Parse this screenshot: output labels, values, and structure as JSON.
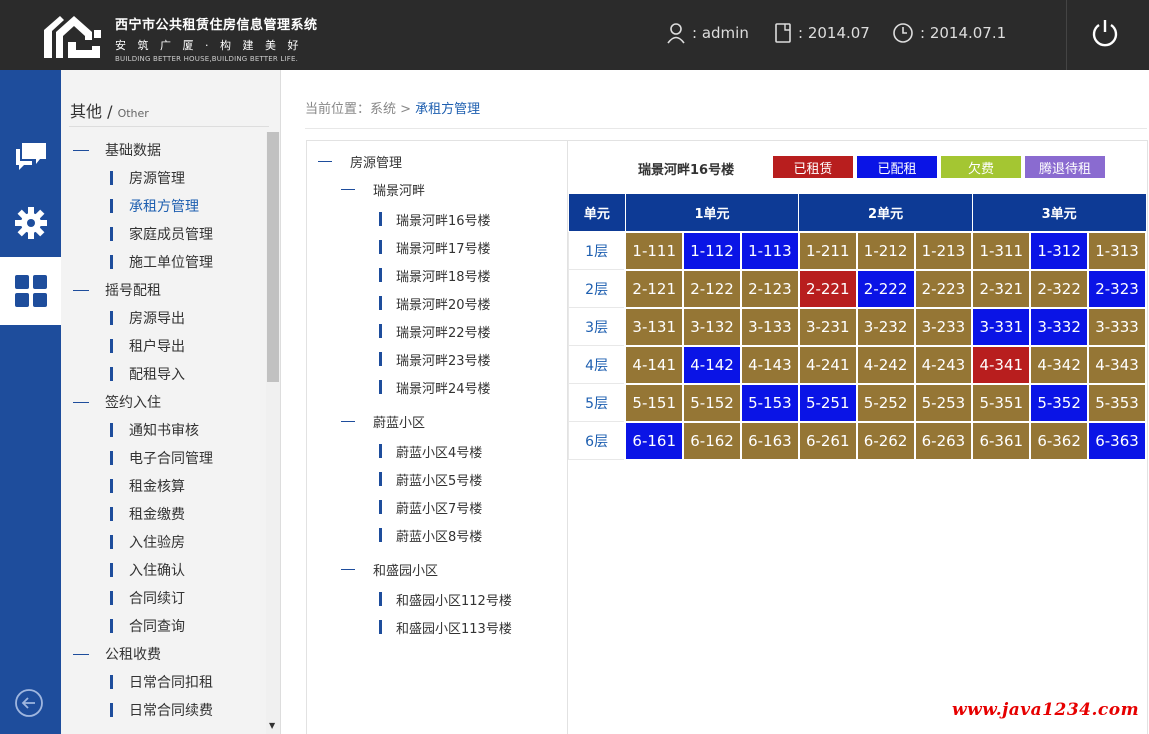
{
  "header": {
    "title": "西宁市公共租赁住房信息管理系统",
    "slogan": "安 筑 广 厦 · 构 建 美 好",
    "slogan_en": "BUILDING BETTER HOUSE,BUILDING BETTER LIFE.",
    "user_label": ": admin",
    "period_label": ": 2014.07",
    "date_label": ": 2014.07.1"
  },
  "sidebar": {
    "title": "其他",
    "title_sep": " / ",
    "title_en": "Other",
    "groups": [
      {
        "label": "基础数据",
        "items": [
          "房源管理",
          "承租方管理",
          "家庭成员管理",
          "施工单位管理"
        ]
      },
      {
        "label": "摇号配租",
        "items": [
          "房源导出",
          "租户导出",
          "配租导入"
        ]
      },
      {
        "label": "签约入住",
        "items": [
          "通知书审核",
          "电子合同管理",
          "租金核算",
          "租金缴费",
          "入住验房",
          "入住确认",
          "合同续订",
          "合同查询"
        ]
      },
      {
        "label": "公租收费",
        "items": [
          "日常合同扣租",
          "日常合同续费"
        ]
      }
    ],
    "active_item": "承租方管理"
  },
  "breadcrumb": {
    "prefix": "当前位置：系统 > ",
    "current": "承租方管理"
  },
  "tree": {
    "root": "房源管理",
    "groups": [
      {
        "label": "瑞景河畔",
        "items": [
          "瑞景河畔16号楼",
          "瑞景河畔17号楼",
          "瑞景河畔18号楼",
          "瑞景河畔20号楼",
          "瑞景河畔22号楼",
          "瑞景河畔23号楼",
          "瑞景河畔24号楼"
        ]
      },
      {
        "label": "蔚蓝小区",
        "items": [
          "蔚蓝小区4号楼",
          "蔚蓝小区5号楼",
          "蔚蓝小区7号楼",
          "蔚蓝小区8号楼"
        ]
      },
      {
        "label": "和盛园小区",
        "items": [
          "和盛园小区112号楼",
          "和盛园小区113号楼"
        ]
      }
    ]
  },
  "building": {
    "name": "瑞景河畔16号楼",
    "legend": [
      {
        "label": "已租赁",
        "color": "#b81e1e"
      },
      {
        "label": "已配租",
        "color": "#0a14e6"
      },
      {
        "label": "欠费",
        "color": "#a4c632"
      },
      {
        "label": "腾退待租",
        "color": "#8a6bd0"
      }
    ],
    "colors": {
      "R": "#b81e1e",
      "A": "#0a14e6",
      "N": "#957635"
    },
    "unit_header": "单元",
    "units": [
      "1单元",
      "2单元",
      "3单元"
    ],
    "floors": [
      {
        "label": "1层",
        "rooms": [
          "1-111",
          "1-112",
          "1-113",
          "1-211",
          "1-212",
          "1-213",
          "1-311",
          "1-312",
          "1-313"
        ],
        "status": [
          "N",
          "A",
          "A",
          "N",
          "N",
          "N",
          "N",
          "A",
          "N"
        ]
      },
      {
        "label": "2层",
        "rooms": [
          "2-121",
          "2-122",
          "2-123",
          "2-221",
          "2-222",
          "2-223",
          "2-321",
          "2-322",
          "2-323"
        ],
        "status": [
          "N",
          "N",
          "N",
          "R",
          "A",
          "N",
          "N",
          "N",
          "A"
        ]
      },
      {
        "label": "3层",
        "rooms": [
          "3-131",
          "3-132",
          "3-133",
          "3-231",
          "3-232",
          "3-233",
          "3-331",
          "3-332",
          "3-333"
        ],
        "status": [
          "N",
          "N",
          "N",
          "N",
          "N",
          "N",
          "A",
          "A",
          "N"
        ]
      },
      {
        "label": "4层",
        "rooms": [
          "4-141",
          "4-142",
          "4-143",
          "4-241",
          "4-242",
          "4-243",
          "4-341",
          "4-342",
          "4-343"
        ],
        "status": [
          "N",
          "A",
          "N",
          "N",
          "N",
          "N",
          "R",
          "N",
          "N"
        ]
      },
      {
        "label": "5层",
        "rooms": [
          "5-151",
          "5-152",
          "5-153",
          "5-251",
          "5-252",
          "5-253",
          "5-351",
          "5-352",
          "5-353"
        ],
        "status": [
          "N",
          "N",
          "A",
          "A",
          "N",
          "N",
          "N",
          "A",
          "N"
        ]
      },
      {
        "label": "6层",
        "rooms": [
          "6-161",
          "6-162",
          "6-163",
          "6-261",
          "6-262",
          "6-263",
          "6-361",
          "6-362",
          "6-363"
        ],
        "status": [
          "A",
          "N",
          "N",
          "N",
          "N",
          "N",
          "N",
          "N",
          "A"
        ]
      }
    ]
  },
  "watermark": "www.java1234.com"
}
